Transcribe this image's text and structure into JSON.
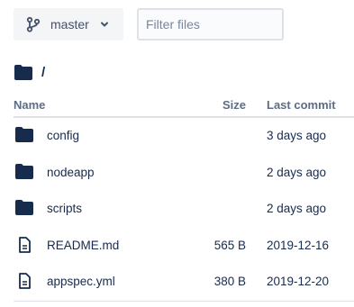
{
  "branch": {
    "label": "master",
    "icon": "git-branch-icon"
  },
  "filter": {
    "placeholder": "Filter files",
    "value": ""
  },
  "breadcrumb": {
    "icon": "folder-icon",
    "path": "/"
  },
  "table": {
    "columns": {
      "name": "Name",
      "size": "Size",
      "commit": "Last commit"
    },
    "rows": [
      {
        "type": "folder",
        "icon": "folder-icon",
        "name": "config",
        "size": "",
        "commit": "3 days ago"
      },
      {
        "type": "folder",
        "icon": "folder-icon",
        "name": "nodeapp",
        "size": "",
        "commit": "2 days ago"
      },
      {
        "type": "folder",
        "icon": "folder-icon",
        "name": "scripts",
        "size": "",
        "commit": "2 days ago"
      },
      {
        "type": "file",
        "icon": "file-icon",
        "name": "README.md",
        "size": "565 B",
        "commit": "2019-12-16"
      },
      {
        "type": "file",
        "icon": "file-icon",
        "name": "appspec.yml",
        "size": "380 B",
        "commit": "2019-12-20"
      }
    ]
  },
  "colors": {
    "text": "#172b4d",
    "muted": "#5e6c84",
    "border": "#dfe1e6",
    "button_bg": "#f4f5f7"
  }
}
